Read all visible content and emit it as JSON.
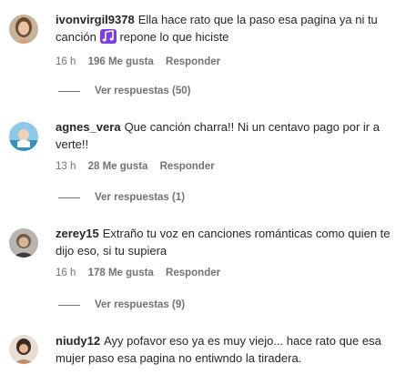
{
  "comments": [
    {
      "username": "ivonvirgil9378",
      "text_before_icon": "Ella hace rato que la paso esa pagina ya ni tu canción",
      "icon": "music-note-icon",
      "text_after_icon": "repone lo que hiciste",
      "time": "16 h",
      "likes": "196 Me gusta",
      "reply": "Responder",
      "view_replies": "Ver respuestas (50)"
    },
    {
      "username": "agnes_vera",
      "text": "Que canción charra!! Ni un centavo pago por ir a verte!!",
      "time": "13 h",
      "likes": "28 Me gusta",
      "reply": "Responder",
      "view_replies": "Ver respuestas (1)"
    },
    {
      "username": "zerey15",
      "text": "Extraño tu voz en canciones románticas como quien te dijo eso, si tu supiera",
      "time": "16 h",
      "likes": "178 Me gusta",
      "reply": "Responder",
      "view_replies": "Ver respuestas (9)"
    },
    {
      "username": "niudy12",
      "text": "Ayy pofavor eso ya es muy viejo... hace rato que esa mujer paso esa pagina no entiwndo la tiradera."
    }
  ],
  "colors": {
    "text": "#262626",
    "secondary": "#737373",
    "note_icon": "#7b3fe4"
  }
}
